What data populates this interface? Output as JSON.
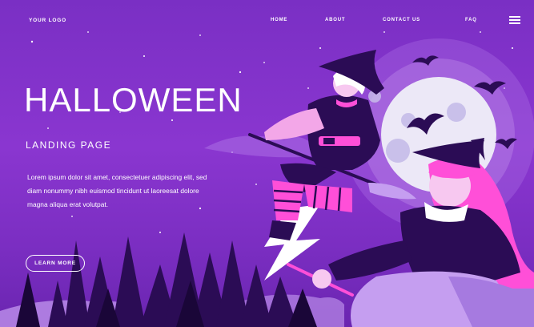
{
  "header": {
    "logo": "YOUR LOGO",
    "nav": [
      "HOME",
      "ABOUT",
      "CONTACT US",
      "FAQ"
    ],
    "menu_icon": "hamburger-menu-icon"
  },
  "hero": {
    "title": "HALLOWEEN",
    "subtitle": "LANDING PAGE",
    "description": "Lorem ipsum dolor sit amet, consectetuer adipiscing elit, sed diam nonummy nibh euismod tincidunt ut laoreesat dolore magna aliqua erat volutpat.",
    "cta_label": "LEARN MORE"
  },
  "colors": {
    "background": "#8a36d0",
    "dark_purple": "#2b0c55",
    "pink": "#ff4fd8",
    "moon": "#ece8f7"
  }
}
